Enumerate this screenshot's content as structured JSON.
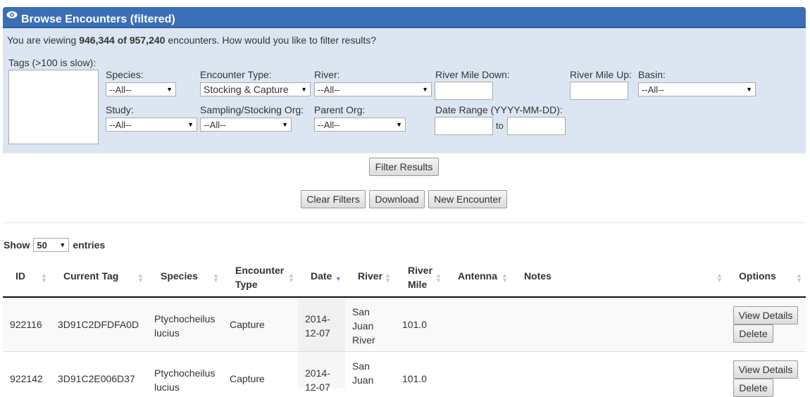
{
  "panel": {
    "title": "Browse Encounters (filtered)"
  },
  "summary": {
    "prefix": "You are viewing ",
    "viewing": "946,344",
    "of": " of ",
    "total": "957,240",
    "suffix": " encounters. How would you like to filter results?"
  },
  "filters": {
    "tags_label": "Tags (>100 is slow):",
    "species_label": "Species:",
    "species_value": "--All--",
    "encounter_type_label": "Encounter Type:",
    "encounter_type_value": "Stocking & Capture",
    "river_label": "River:",
    "river_value": "--All--",
    "river_mile_down_label": "River Mile Down:",
    "river_mile_up_label": "River Mile Up:",
    "basin_label": "Basin:",
    "basin_value": "--All--",
    "study_label": "Study:",
    "study_value": "--All--",
    "sampling_org_label": "Sampling/Stocking Org:",
    "sampling_org_value": "--All--",
    "parent_org_label": "Parent Org:",
    "parent_org_value": "--All--",
    "date_range_label": "Date Range (YYYY-MM-DD):",
    "date_to": "to"
  },
  "actions": {
    "filter": "Filter Results",
    "clear": "Clear Filters",
    "download": "Download",
    "new": "New Encounter"
  },
  "table": {
    "show": "Show",
    "entries_value": "50",
    "entries": "entries",
    "headers": {
      "id": "ID",
      "tag": "Current Tag",
      "species": "Species",
      "enc1": "Encounter",
      "enc2": "Type",
      "date": "Date",
      "river": "River",
      "mile1": "River",
      "mile2": "Mile",
      "antenna": "Antenna",
      "notes": "Notes",
      "options": "Options"
    },
    "rows": [
      {
        "id": "922116",
        "tag": "3D91C2DFDFA0D",
        "species1": "Ptychocheilus",
        "species2": "lucius",
        "type": "Capture",
        "date1": "2014-",
        "date2": "12-07",
        "river1": "San",
        "river2": "Juan",
        "river3": "River",
        "mile": "101.0",
        "view": "View Details",
        "delete": "Delete"
      },
      {
        "id": "922142",
        "tag": "3D91C2E006D37",
        "species1": "Ptychocheilus",
        "species2": "lucius",
        "type": "Capture",
        "date1": "2014-",
        "date2": "12-07",
        "river1": "San",
        "river2": "Juan",
        "mile": "101.0",
        "view": "View Details",
        "delete": "Delete"
      }
    ]
  }
}
